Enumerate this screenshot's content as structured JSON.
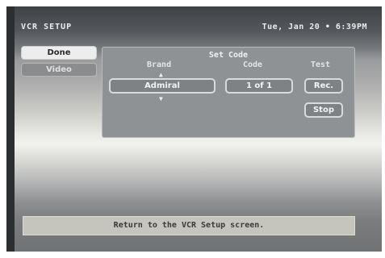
{
  "header": {
    "title": "VCR SETUP",
    "datetime": "Tue, Jan 20 • 6:39PM"
  },
  "sidebar": {
    "done_label": "Done",
    "video_label": "Video"
  },
  "panel": {
    "title": "Set Code",
    "brand_header": "Brand",
    "code_header": "Code",
    "test_header": "Test",
    "brand_value": "Admiral",
    "code_value": "1 of 1",
    "rec_label": "Rec.",
    "stop_label": "Stop"
  },
  "status": {
    "message": "Return to the VCR Setup screen."
  }
}
